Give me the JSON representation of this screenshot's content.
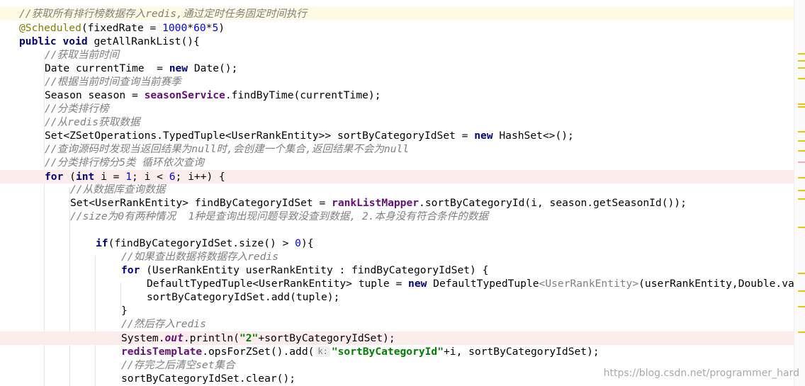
{
  "code": {
    "l1": "//获取所有排行榜数据存入redis,通过定时任务固定时间执行",
    "l2_annotation": "@Scheduled",
    "l2_args": "(fixedRate = ",
    "l2_n1": "1000",
    "l2_n2": "60",
    "l2_n3": "5",
    "l3_public": "public",
    "l3_void": "void",
    "l3_rest": " getAllRankList(){",
    "l4": "//获取当前时间",
    "l5_a": "Date currentTime  = ",
    "l5_new": "new",
    "l5_b": " Date();",
    "l6": "//根据当前时间查询当前赛季",
    "l7_a": "Season season = ",
    "l7_field": "seasonService",
    "l7_b": ".findByTime(currentTime);",
    "l8": "//分类排行榜",
    "l9": "//从redis获取数据",
    "l10_a": "Set<ZSetOperations.TypedTuple<UserRankEntity>> sortByCategoryIdSet = ",
    "l10_new": "new",
    "l10_b": " HashSet<>();",
    "l11": "//查询源码时发现当返回结果为null时,会创建一个集合,返回结果不会为null",
    "l12": "//分类排行榜分5类 循环依次查询",
    "l13_for": "for",
    "l13_a": " (",
    "l13_int": "int",
    "l13_b": " i = ",
    "l13_n1": "1",
    "l13_c": "; i < ",
    "l13_n2": "6",
    "l13_d": "; i++) {",
    "l14": "//从数据库查询数据",
    "l15_a": "Set<UserRankEntity> findByCategoryIdSet = ",
    "l15_field": "rankListMapper",
    "l15_b": ".sortByCategoryId(i, season.getSeasonId());",
    "l16": "//size为0有两种情况  1种是查询出现问题导致没查到数据, 2.本身没有符合条件的数据",
    "l18_if": "if",
    "l18_a": "(findByCategoryIdSet.size() > ",
    "l18_n": "0",
    "l18_b": "){",
    "l19": "//如果查出数据将数据存入redis",
    "l20_for": "for",
    "l20_a": " (UserRankEntity userRankEntity : findByCategoryIdSet) {",
    "l21_a": "DefaultTypedTuple<UserRankEntity> tuple = ",
    "l21_new": "new",
    "l21_b": " DefaultTypedTuple",
    "l21_gen": "<UserRankEntity>",
    "l21_c": "(userRankEntity,Double.value",
    "l22": "sortByCategoryIdSet.add(tuple);",
    "l23": "}",
    "l24": "//然后存入redis",
    "l25_a": "System.",
    "l25_out": "out",
    "l25_b": ".println(",
    "l25_str": "\"2\"",
    "l25_c": "+sortByCategoryIdSet);",
    "l26_field": "redisTemplate",
    "l26_a": ".opsForZSet().add(",
    "l26_hint": "k:",
    "l26_str": "\"sortByCategoryId\"",
    "l26_b": "+i, sortByCategoryIdSet);",
    "l27": "//存完之后清空set集合",
    "l28": "sortByCategoryIdSet.clear();"
  },
  "watermark": "https://blog.csdn.net/programmer_hard",
  "colors": {
    "keyword": "#000080",
    "comment": "#808080",
    "annotation": "#808000",
    "number": "#0000ff",
    "string": "#008000",
    "field": "#660e7a",
    "caret_row": "#fffae3",
    "highlight_row": "#fceded"
  }
}
